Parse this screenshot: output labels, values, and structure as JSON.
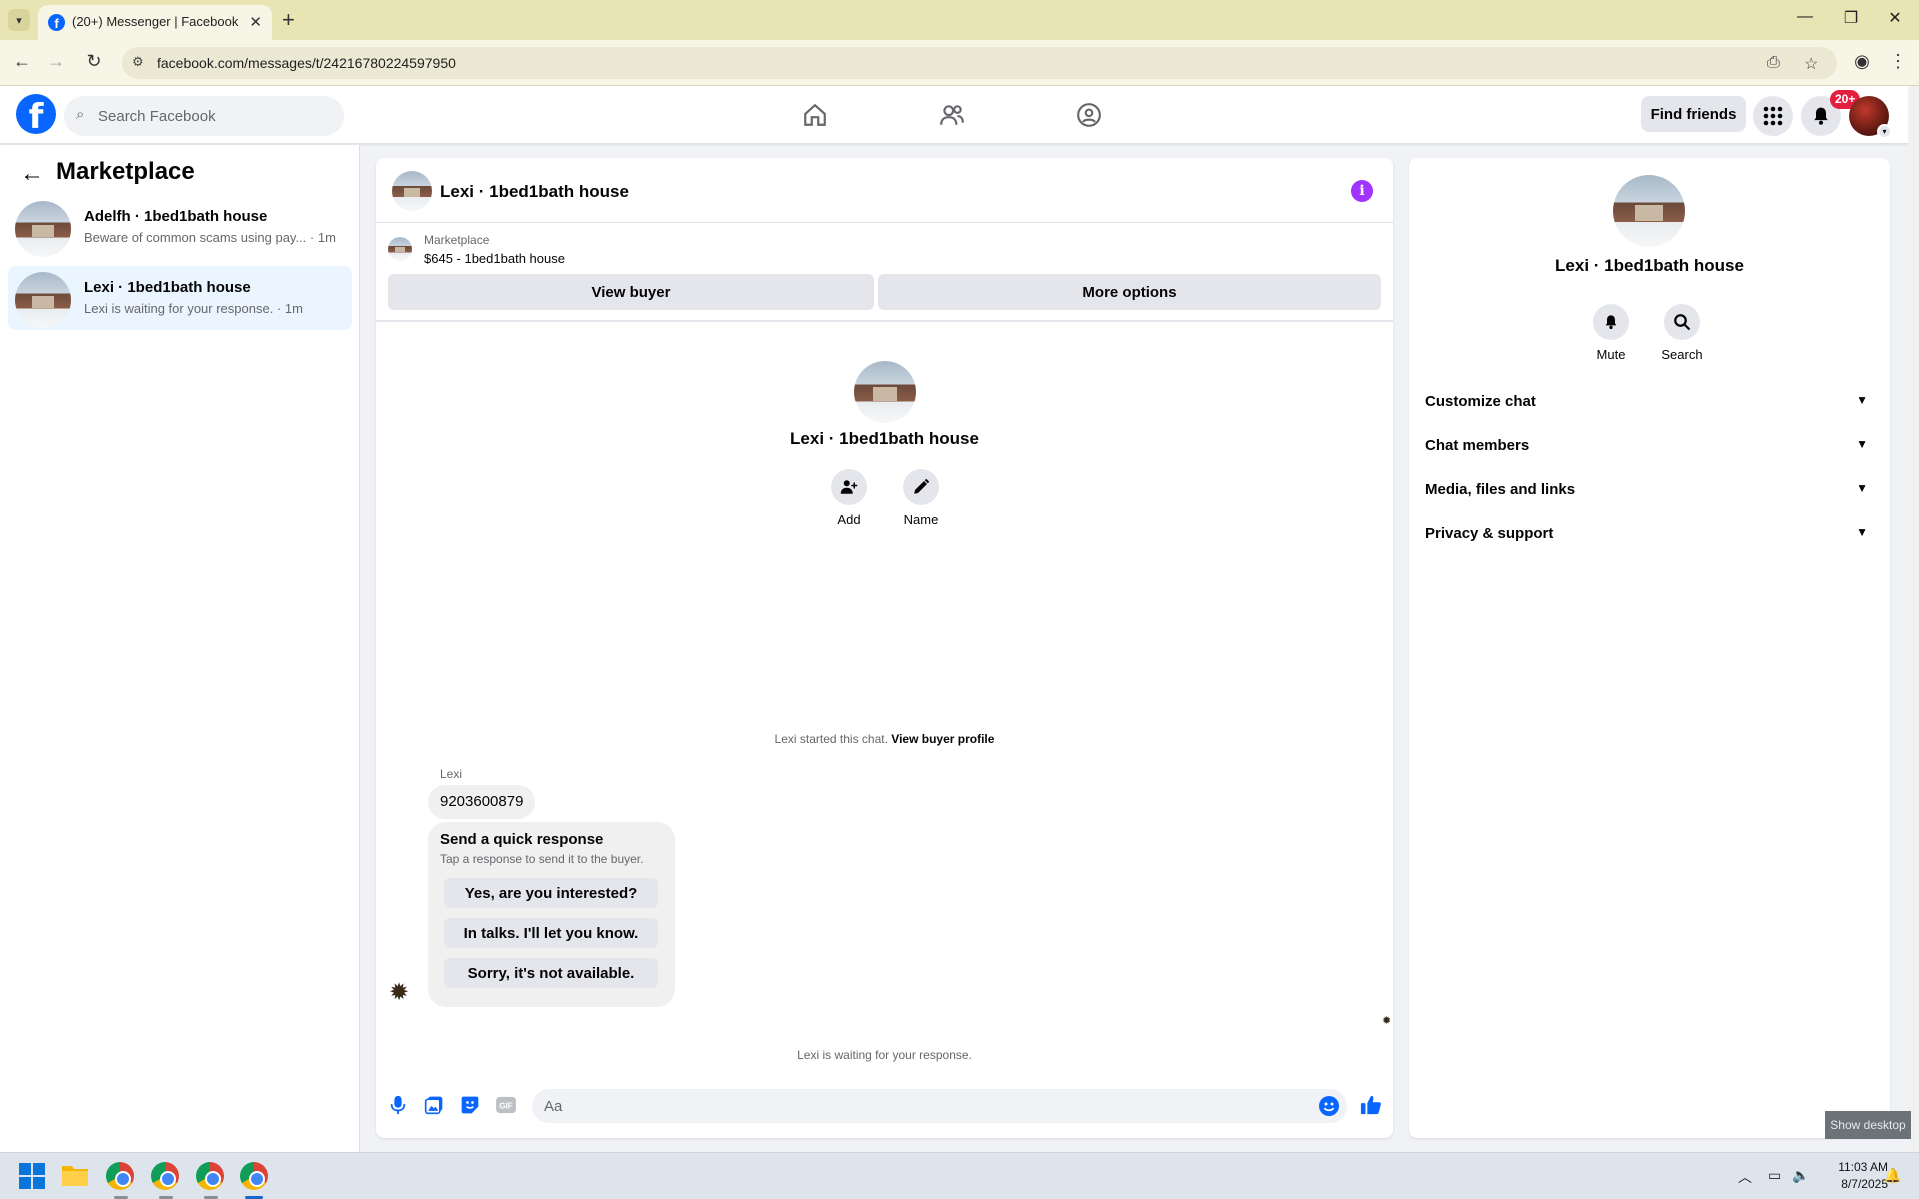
{
  "browser": {
    "tab_title": "(20+) Messenger | Facebook",
    "url": "facebook.com/messages/t/24216780224597950"
  },
  "facebook_bar": {
    "search_placeholder": "Search Facebook",
    "find_friends": "Find friends",
    "notification_badge": "20+"
  },
  "sidebar": {
    "heading": "Marketplace",
    "conversations": [
      {
        "name": "Adelfh · 1bed1bath house",
        "snippet": "Beware of common scams using pay... · 1m",
        "active": false
      },
      {
        "name": "Lexi · 1bed1bath house",
        "snippet": "Lexi is waiting for your response. · 1m",
        "active": true
      }
    ]
  },
  "chat": {
    "title": "Lexi · 1bed1bath house",
    "marketplace_label": "Marketplace",
    "listing": "$645 - 1bed1bath house",
    "view_buyer": "View buyer",
    "more_options": "More options",
    "center_name": "Lexi · 1bed1bath house",
    "actions": [
      {
        "label": "Add"
      },
      {
        "label": "Name"
      }
    ],
    "started_text": "Lexi started this chat.",
    "view_buyer_profile": "View buyer profile",
    "sender": "Lexi",
    "message": "9203600879",
    "quick_response": {
      "title": "Send a quick response",
      "subtitle": "Tap a response to send it to the buyer.",
      "options": [
        "Yes, are you interested?",
        "In talks. I'll let you know.",
        "Sorry, it's not available."
      ]
    },
    "waiting_text": "Lexi is waiting for your response.",
    "composer_placeholder": "Aa"
  },
  "details": {
    "name": "Lexi · 1bed1bath house",
    "actions": [
      {
        "label": "Mute"
      },
      {
        "label": "Search"
      }
    ],
    "sections": [
      "Customize chat",
      "Chat members",
      "Media, files and links",
      "Privacy & support"
    ]
  },
  "desktop": {
    "show_desktop": "Show desktop"
  },
  "taskbar": {
    "time": "11:03 AM",
    "date": "8/7/2025"
  },
  "colors": {
    "brand_blue": "#0866ff",
    "info_purple": "#a033ff",
    "badge_red": "#e41e3f",
    "active_conversation_bg": "#ebf5ff"
  }
}
